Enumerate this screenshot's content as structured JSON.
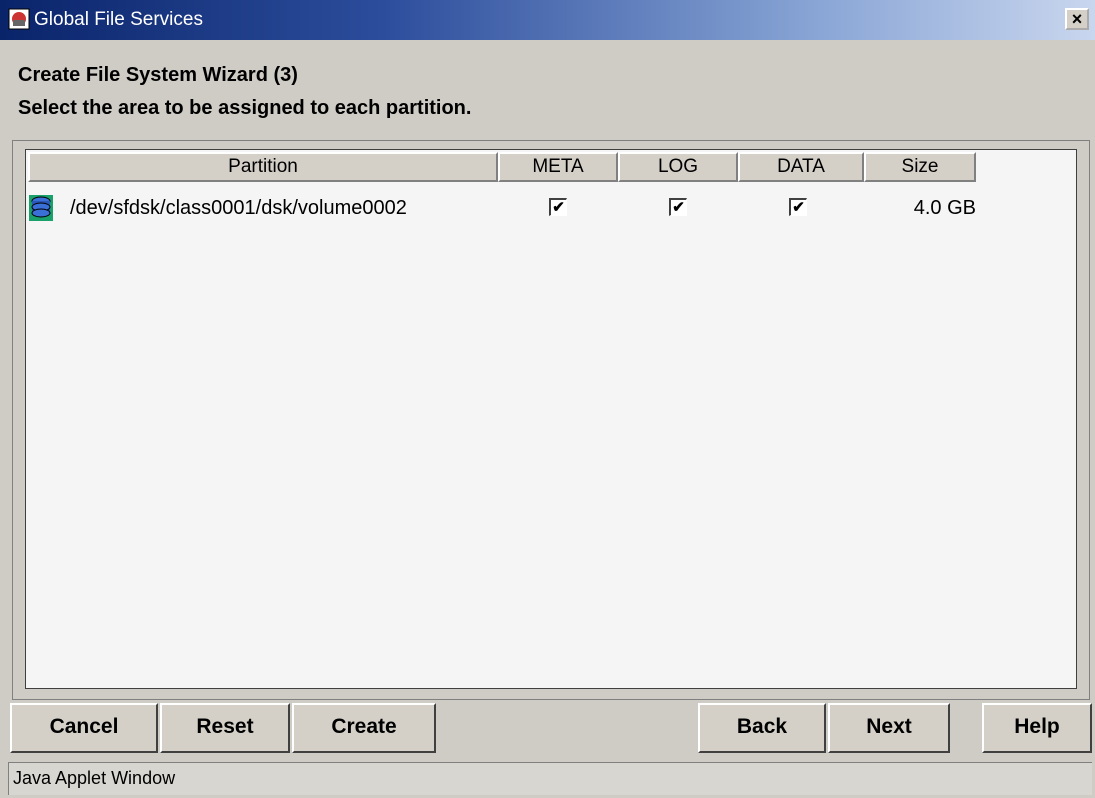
{
  "window": {
    "title": "Global File Services",
    "close_label": "×"
  },
  "wizard": {
    "heading": "Create File System Wizard (3)",
    "instruction": "Select the area to be assigned to each partition."
  },
  "table": {
    "columns": [
      "Partition",
      "META",
      "LOG",
      "DATA",
      "Size"
    ],
    "rows": [
      {
        "partition": "/dev/sfdsk/class0001/dsk/volume0002",
        "meta_mark": "✔",
        "log_mark": "✔",
        "data_mark": "✔",
        "size": "4.0 GB"
      }
    ]
  },
  "buttons": {
    "cancel": "Cancel",
    "reset": "Reset",
    "create": "Create",
    "back": "Back",
    "next": "Next",
    "help": "Help"
  },
  "status": "Java Applet Window",
  "colors": {
    "title_start": "#0a246a",
    "title_end": "#c9d6ee",
    "face": "#d4d0c8",
    "table_bg": "#f5f5f5"
  }
}
